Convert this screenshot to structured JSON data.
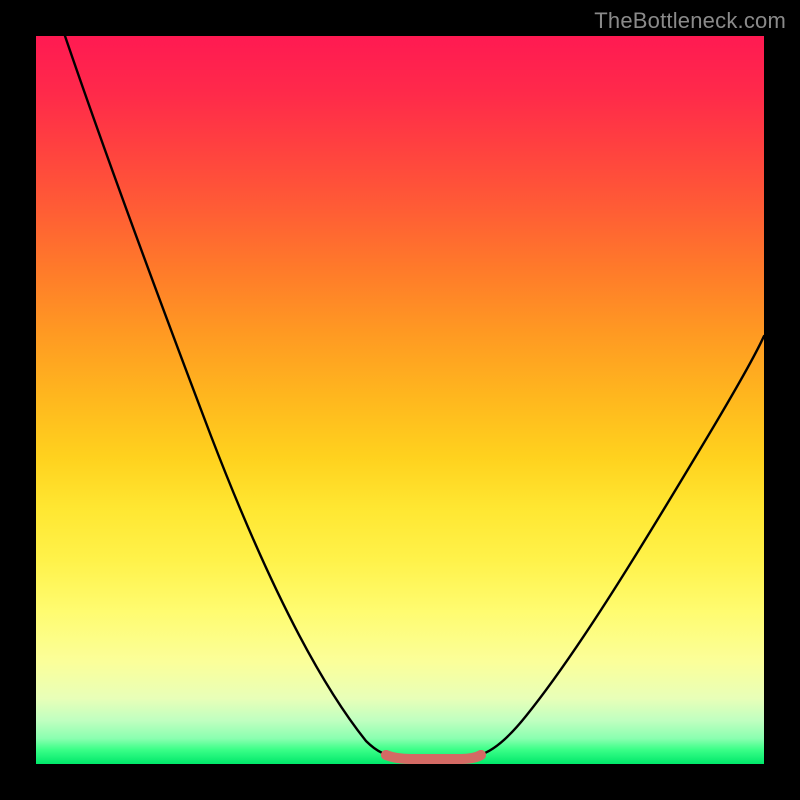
{
  "watermark": {
    "text": "TheBottleneck.com"
  },
  "colors": {
    "frame": "#000000",
    "curve_stroke": "#000000",
    "highlight_stroke": "#d46a64",
    "watermark": "#8a8a8a",
    "gradient_top": "#ff1a52",
    "gradient_bottom": "#00e86a"
  },
  "chart_data": {
    "type": "line",
    "title": "",
    "xlabel": "",
    "ylabel": "",
    "xlim": [
      0,
      1
    ],
    "ylim": [
      0,
      1
    ],
    "note": "Axes are unlabeled; values are estimated in a normalized 0–1 space. y=0 at the green band (bottom), y=1 at the red band (top).",
    "series": [
      {
        "name": "left-descending-branch",
        "x": [
          0.04,
          0.1,
          0.16,
          0.22,
          0.28,
          0.34,
          0.4,
          0.45,
          0.48
        ],
        "y": [
          1.0,
          0.84,
          0.68,
          0.53,
          0.38,
          0.24,
          0.12,
          0.04,
          0.015
        ]
      },
      {
        "name": "flat-highlighted-minimum",
        "x": [
          0.48,
          0.51,
          0.545,
          0.58,
          0.61
        ],
        "y": [
          0.015,
          0.01,
          0.01,
          0.01,
          0.015
        ]
      },
      {
        "name": "right-ascending-branch",
        "x": [
          0.61,
          0.66,
          0.72,
          0.78,
          0.84,
          0.9,
          0.96,
          1.0
        ],
        "y": [
          0.015,
          0.06,
          0.14,
          0.23,
          0.33,
          0.43,
          0.53,
          0.6
        ]
      }
    ],
    "highlight": {
      "series": "flat-highlighted-minimum",
      "color": "#d46a64"
    }
  }
}
